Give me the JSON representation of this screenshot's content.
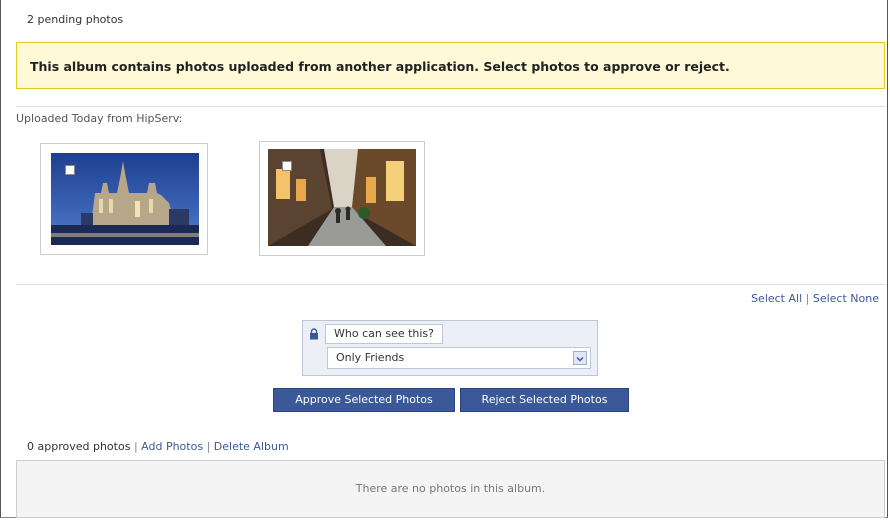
{
  "header": {
    "pending_text": "2 pending photos"
  },
  "notice": {
    "text": "This album contains photos uploaded from another application. Select photos to approve or reject."
  },
  "uploads": {
    "label": "Uploaded Today from HipServ:",
    "photos": [
      {
        "subject": "cathedral-night-photo",
        "selected": false
      },
      {
        "subject": "city-street-photo",
        "selected": false
      }
    ]
  },
  "selection": {
    "select_all": "Select All",
    "separator": "|",
    "select_none": "Select None"
  },
  "privacy": {
    "question": "Who can see this?",
    "selected_option": "Only Friends",
    "icon": "lock-icon"
  },
  "actions": {
    "approve_label": "Approve Selected Photos",
    "reject_label": "Reject Selected Photos"
  },
  "approved": {
    "count_text": "0 approved photos",
    "separator": "|",
    "add_photos": "Add Photos",
    "delete_album": "Delete Album",
    "empty_text": "There are no photos in this album."
  },
  "colors": {
    "notice_bg": "#fff9d7",
    "notice_border": "#e2c822",
    "button_bg": "#3b5998",
    "link": "#3b5998"
  }
}
